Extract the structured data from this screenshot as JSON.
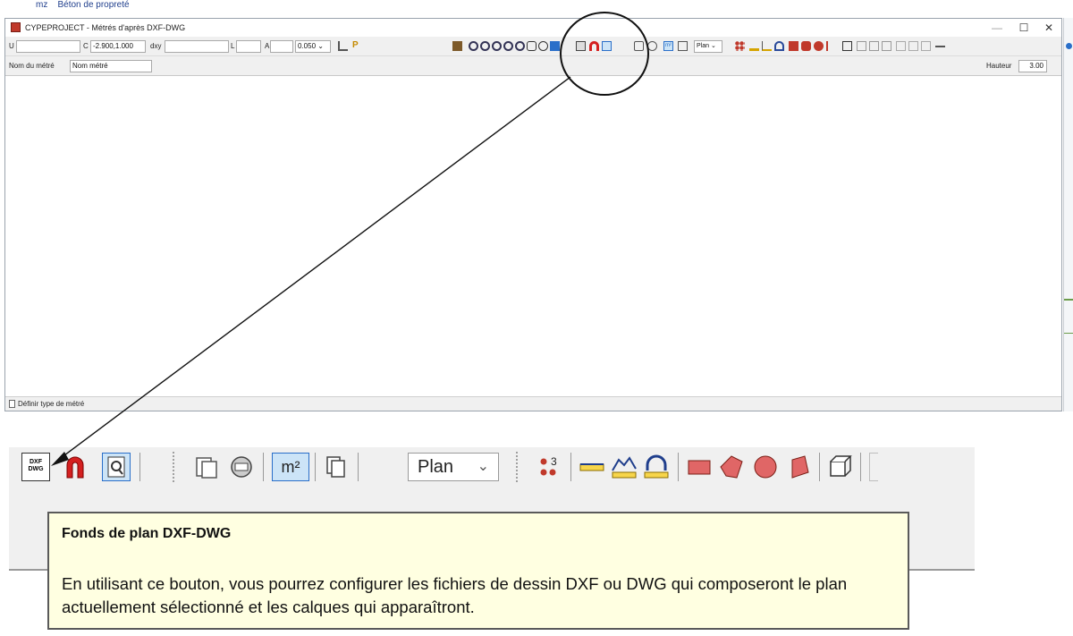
{
  "top_strip": {
    "crumb_a": "mz",
    "crumb_b": "Béton de propreté"
  },
  "window": {
    "title": "CYPEPROJECT - Métrés d'après DXF-DWG",
    "controls": {
      "minimize": "—",
      "maximize": "☐",
      "close": "✕"
    }
  },
  "toolbar1": {
    "u_label": "U",
    "c_label": "C",
    "c_value": "-2.900,1.000",
    "dxy_label": "dxy",
    "l_label": "L",
    "a_label": "A",
    "precision_value": "0.050",
    "view_select": "Plan"
  },
  "toolbar2": {
    "name_label": "Nom du métré",
    "name_value": "Nom métré",
    "height_label": "Hauteur",
    "height_value": "3.00"
  },
  "status": {
    "text": "Définir type de métré"
  },
  "zoom": {
    "m2_label": "m²",
    "view_select": "Plan",
    "points_label": "3"
  },
  "tooltip": {
    "title": "Fonds de plan DXF-DWG",
    "body": "En utilisant ce bouton, vous pourrez configurer les fichiers de dessin DXF ou DWG qui composeront le plan actuellement sélectionné et les calques qui apparaîtront."
  },
  "colors": {
    "tooltip_bg": "#ffffe1",
    "magnet_red": "#d42020",
    "selected_blue": "#cce4f7",
    "toolbar_bg": "#f0f0f0"
  }
}
